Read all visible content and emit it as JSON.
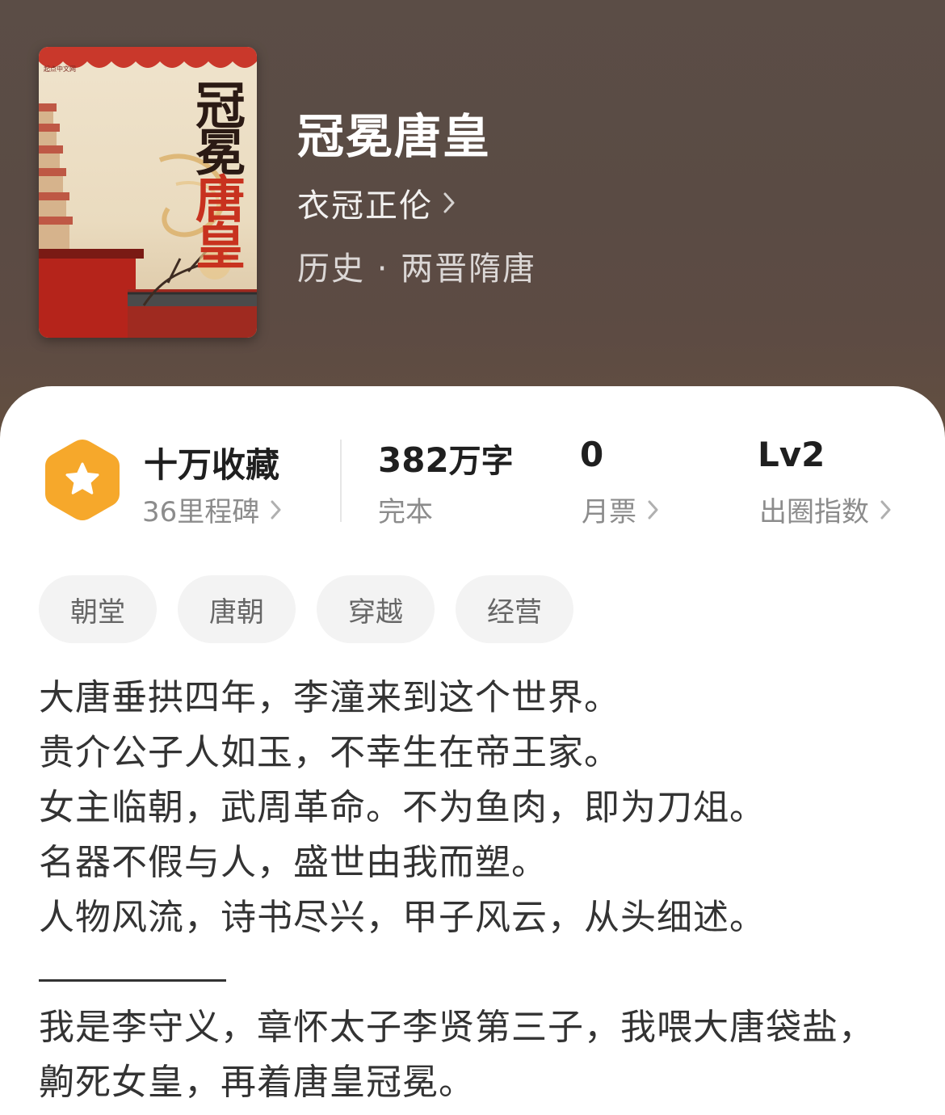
{
  "book": {
    "cover": {
      "publisher_text": "起点中文网",
      "title_chars": [
        "冠",
        "冕",
        "唐",
        "皇"
      ]
    },
    "title": "冠冕唐皇",
    "author": "衣冠正伦",
    "genre": "历史 · 两晋隋唐"
  },
  "stats": {
    "favorites": {
      "value": "十万收藏",
      "label": "36里程碑"
    },
    "words": {
      "number": "382",
      "unit": "万字",
      "label": "完本"
    },
    "monthly_votes": {
      "value": "0",
      "label": "月票"
    },
    "influence": {
      "value": "Lv2",
      "label": "出圈指数"
    }
  },
  "tags": [
    "朝堂",
    "唐朝",
    "穿越",
    "经营"
  ],
  "synopsis": {
    "lines": [
      "大唐垂拱四年，李潼来到这个世界。",
      "贵介公子人如玉，不幸生在帝王家。",
      "女主临朝，武周革命。不为鱼肉，即为刀俎。",
      "名器不假与人，盛世由我而塑。",
      "人物风流，诗书尽兴，甲子风云，从头细述。"
    ],
    "lines_after": [
      "我是李守义，章怀太子李贤第三子，我喂大唐袋盐，",
      "齁死女皇，再着唐皇冠冕。"
    ]
  },
  "colors": {
    "header_bg": "#5a4b44",
    "badge_orange": "#f5a623",
    "text_primary": "#1f1f1f",
    "text_secondary": "#8c8c8c",
    "tag_bg": "#f3f3f3"
  },
  "icons": {
    "badge": "star-hexagon-icon",
    "chevron": "chevron-right-icon"
  }
}
